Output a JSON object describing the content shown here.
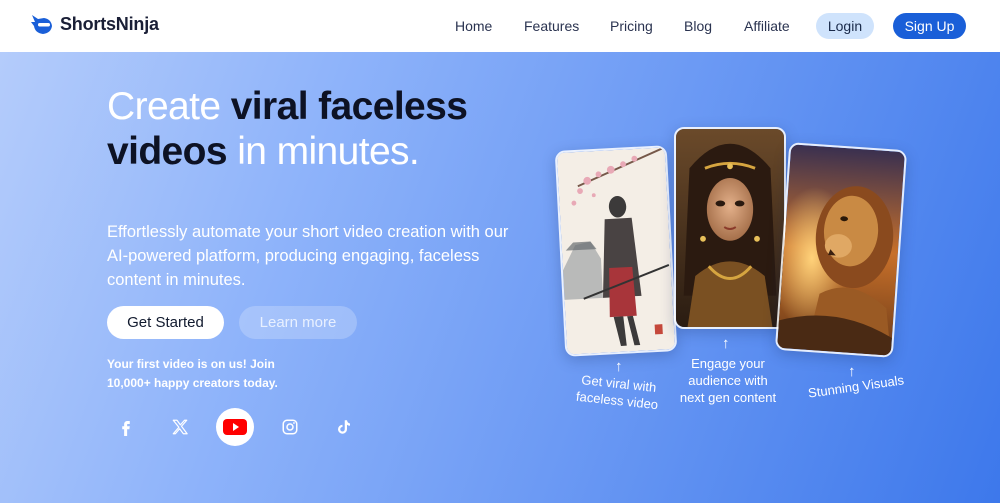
{
  "brand": {
    "name": "ShortsNinja",
    "color": "#1a5fd8",
    "icon": "ninja-head-icon"
  },
  "nav": {
    "items": [
      {
        "label": "Home"
      },
      {
        "label": "Features"
      },
      {
        "label": "Pricing"
      },
      {
        "label": "Blog"
      },
      {
        "label": "Affiliate"
      }
    ],
    "login_label": "Login",
    "signup_label": "Sign Up"
  },
  "hero": {
    "title_part1": "Create ",
    "title_bold1": "viral faceless videos",
    "title_part2": " in minutes.",
    "subtitle": "Effortlessly automate your short video creation with our AI-powered platform, producing engaging, faceless content in minutes.",
    "get_started_label": "Get Started",
    "learn_more_label": "Learn more",
    "promo_line1": "Your first video is on us! Join",
    "promo_line2": "10,000+ happy creators today."
  },
  "socials": [
    {
      "icon": "facebook-icon"
    },
    {
      "icon": "x-twitter-icon"
    },
    {
      "icon": "youtube-icon",
      "active": true
    },
    {
      "icon": "instagram-icon"
    },
    {
      "icon": "tiktok-icon"
    }
  ],
  "cards": [
    {
      "caption_line1": "Get viral with",
      "caption_line2": "faceless video",
      "arrow": "↑"
    },
    {
      "caption_line1": "Engage your",
      "caption_line2": "audience with",
      "caption_line3": "next gen content",
      "arrow": "↑"
    },
    {
      "caption_line1": "Stunning Visuals",
      "arrow": "↑"
    }
  ]
}
